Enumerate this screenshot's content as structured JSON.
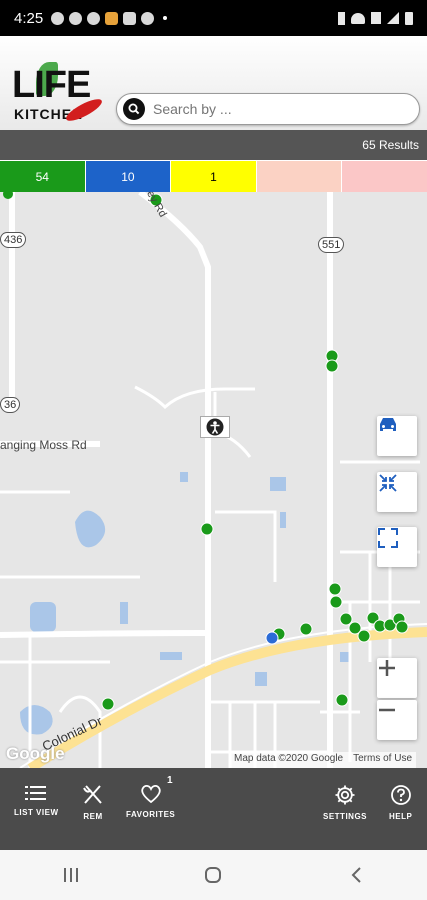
{
  "status_bar": {
    "time": "4:25"
  },
  "header": {
    "logo_top": "LIFE",
    "logo_bottom": "KITCHEN",
    "search_placeholder": "Search by ..."
  },
  "results": {
    "label": "65 Results"
  },
  "filters": [
    {
      "label": "54",
      "color": "#1a9a1a",
      "text_color": "#ffffff"
    },
    {
      "label": "10",
      "color": "#1d63c9",
      "text_color": "#ffffff"
    },
    {
      "label": "1",
      "color": "#ffff00",
      "text_color": "#000000"
    },
    {
      "label": "",
      "color": "#fbd2c4",
      "text_color": "#000000"
    },
    {
      "label": "",
      "color": "#fbc7c7",
      "text_color": "#000000"
    }
  ],
  "map": {
    "route_shields": [
      "436",
      "551",
      "36"
    ],
    "road_labels": [
      "ey Rd",
      "anging Moss Rd",
      "Colonial Dr"
    ],
    "attribution": {
      "data": "Map data ©2020 Google",
      "terms": "Terms of Use"
    },
    "google_logo": "Google",
    "marker_colors": {
      "green": "#1a9a1a",
      "blue": "#2b6bd6"
    }
  },
  "bottom_nav": {
    "items": [
      {
        "label": "LIST VIEW",
        "icon": "list-icon"
      },
      {
        "label": "REM",
        "icon": "utensils-icon"
      },
      {
        "label": "FAVORITES",
        "icon": "heart-icon",
        "badge": "1"
      },
      {
        "label": "SETTINGS",
        "icon": "gear-icon"
      },
      {
        "label": "HELP",
        "icon": "help-icon"
      }
    ]
  }
}
